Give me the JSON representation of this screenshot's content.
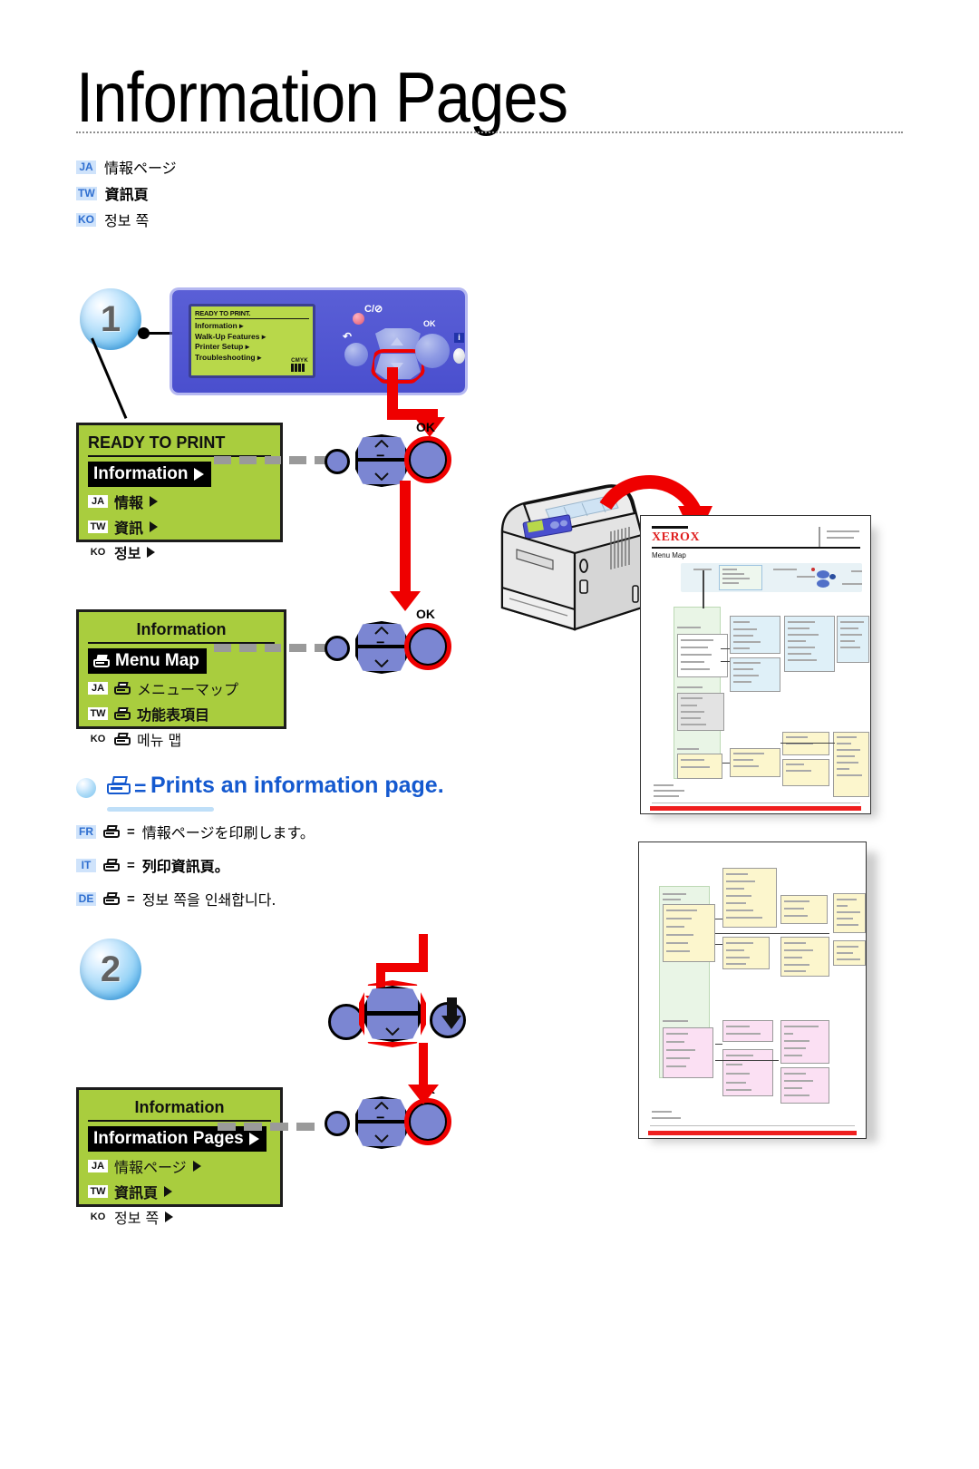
{
  "title": {
    "main": "Information Pages",
    "translations": [
      {
        "code": "JA",
        "text": "情報ページ",
        "bold": false
      },
      {
        "code": "TW",
        "text": "資訊頁",
        "bold": true
      },
      {
        "code": "KO",
        "text": "정보 쪽",
        "bold": false
      }
    ]
  },
  "steps": {
    "one": "1",
    "two": "2"
  },
  "control_panel": {
    "screen_header": "READY TO PRINT.",
    "menu_items": [
      "Information ▸",
      "Walk-Up Features ▸",
      "Printer Setup ▸",
      "Troubleshooting ▸"
    ],
    "cmyk_label": "CMYK",
    "ok_label": "OK",
    "info_glyph": "i",
    "cancel_glyph": "C/⊘",
    "back_glyph": "↶"
  },
  "lcd_panels": [
    {
      "id": "ready-to-print",
      "title": "READY TO PRINT",
      "title_align": "left",
      "selected": "Information",
      "selected_has_arrow": true,
      "selected_has_printer_icon": false,
      "rows": [
        {
          "code": "JA",
          "text": "情報",
          "icon": false,
          "arrow": true
        },
        {
          "code": "TW",
          "text": "資訊",
          "icon": false,
          "arrow": true
        },
        {
          "code": "KO",
          "text": "정보",
          "icon": false,
          "arrow": true
        }
      ]
    },
    {
      "id": "information-menu-map",
      "title": "Information",
      "title_align": "center",
      "selected": "Menu Map",
      "selected_has_arrow": false,
      "selected_has_printer_icon": true,
      "rows": [
        {
          "code": "JA",
          "text": "メニューマップ",
          "icon": true,
          "arrow": false
        },
        {
          "code": "TW",
          "text": "功能表項目",
          "icon": true,
          "arrow": false
        },
        {
          "code": "KO",
          "text": "메뉴 맵",
          "icon": true,
          "arrow": false
        }
      ]
    },
    {
      "id": "information-pages",
      "title": "Information",
      "title_align": "center",
      "selected": "Information Pages",
      "selected_has_arrow": true,
      "selected_has_printer_icon": false,
      "rows": [
        {
          "code": "JA",
          "text": "情報ページ",
          "icon": false,
          "arrow": true
        },
        {
          "code": "TW",
          "text": "資訊頁",
          "icon": false,
          "arrow": true
        },
        {
          "code": "KO",
          "text": "정보 쪽",
          "icon": false,
          "arrow": true
        }
      ]
    }
  ],
  "cluster_ok_label": "OK",
  "cluster_eq": "=",
  "legend": {
    "equals": "=",
    "text": "Prints an information page.",
    "accent_color": "#1459cf",
    "translations": [
      {
        "code": "FR",
        "eq": "=",
        "text": "情報ページを印刷します。",
        "bold": false
      },
      {
        "code": "IT",
        "eq": "=",
        "text": "列印資訊頁。",
        "bold": true
      },
      {
        "code": "DE",
        "eq": "=",
        "text": "정보 쪽을 인쇄합니다.",
        "bold": false
      }
    ]
  },
  "printout": {
    "brand": "XEROX",
    "doc_title": "Menu Map"
  },
  "colors": {
    "lcd_green": "#a9cd3e",
    "panel_blue": "#4a4fce",
    "button_blue": "#7b86d2",
    "red_arrow": "#ef0000",
    "lang_tag_bg": "#cfe3fb",
    "lang_tag_fg": "#2f6fd0"
  }
}
